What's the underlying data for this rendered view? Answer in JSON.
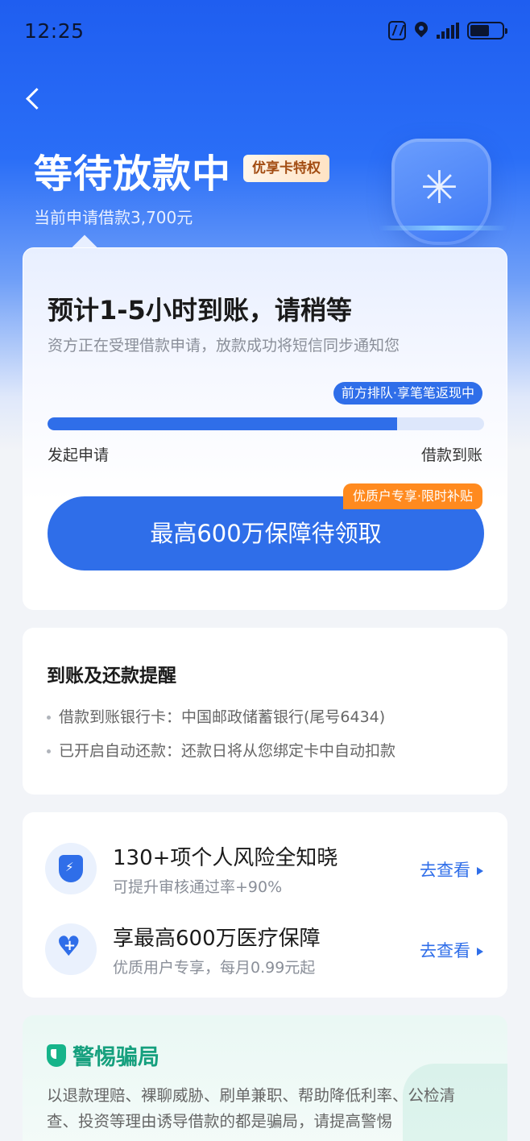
{
  "status_bar": {
    "time": "12:25"
  },
  "header": {
    "title": "等待放款中",
    "badge": "优享卡特权",
    "subtitle": "当前申请借款3,700元"
  },
  "progress_card": {
    "title": "预计1-5小时到账，请稍等",
    "description": "资方正在受理借款申请，放款成功将短信同步通知您",
    "queue_tag": "前方排队·享笔笔返现中",
    "progress_fraction": 0.8,
    "start_label": "发起申请",
    "end_label": "借款到账",
    "cta_label": "最高600万保障待领取",
    "promo_tag": "优质户专享·限时补贴"
  },
  "reminder": {
    "title": "到账及还款提醒",
    "items": [
      "借款到账银行卡：中国邮政储蓄银行(尾号6434)",
      "已开启自动还款：还款日将从您绑定卡中自动扣款"
    ]
  },
  "services": [
    {
      "title": "130+项个人风险全知晓",
      "subtitle": "可提升审核通过率+90%",
      "link": "去查看",
      "icon": "shield-bolt-icon"
    },
    {
      "title": "享最高600万医疗保障",
      "subtitle": "优质用户专享，每月0.99元起",
      "link": "去查看",
      "icon": "heart-plus-icon"
    }
  ],
  "warning": {
    "title": "警惕骗局",
    "text": "以退款理赔、裸聊威胁、刷单兼职、帮助降低利率、公检清查、投资等理由诱导借款的都是骗局，请提高警惕"
  },
  "colors": {
    "primary": "#2f6ee9",
    "accent_orange": "#ff8a1f",
    "warning_green": "#16a07e"
  }
}
